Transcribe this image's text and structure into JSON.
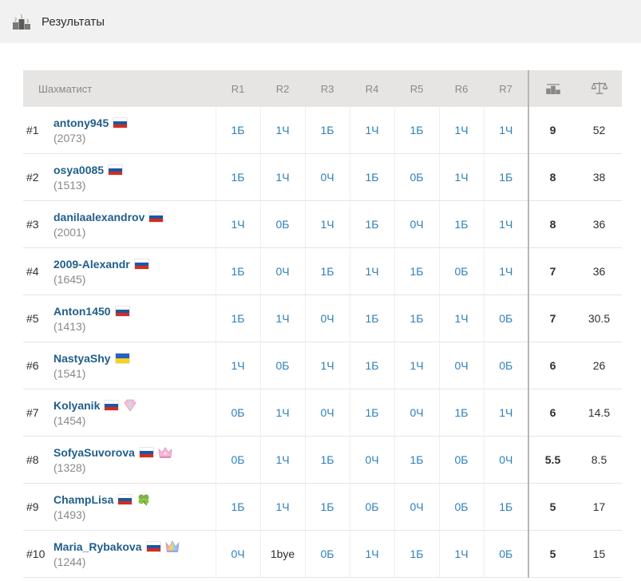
{
  "header": {
    "title": "Результаты"
  },
  "table": {
    "headers": {
      "player": "Шахматист",
      "rounds": [
        "R1",
        "R2",
        "R3",
        "R4",
        "R5",
        "R6",
        "R7"
      ]
    },
    "rows": [
      {
        "rank": "#1",
        "name": "antony945",
        "rating": "(2073)",
        "flag": "ru",
        "badge": "",
        "results": [
          "1Б",
          "1Ч",
          "1Б",
          "1Ч",
          "1Б",
          "1Ч",
          "1Ч"
        ],
        "points": "9",
        "tiebreak": "52"
      },
      {
        "rank": "#2",
        "name": "osya0085",
        "rating": "(1513)",
        "flag": "ru",
        "badge": "",
        "results": [
          "1Б",
          "1Ч",
          "0Ч",
          "1Б",
          "0Б",
          "1Ч",
          "1Б"
        ],
        "points": "8",
        "tiebreak": "38"
      },
      {
        "rank": "#3",
        "name": "danilaalexandrov",
        "rating": "(2001)",
        "flag": "ru",
        "badge": "",
        "results": [
          "1Ч",
          "0Б",
          "1Ч",
          "1Б",
          "0Ч",
          "1Б",
          "1Ч"
        ],
        "points": "8",
        "tiebreak": "36"
      },
      {
        "rank": "#4",
        "name": "2009-Alexandr",
        "rating": "(1645)",
        "flag": "ru",
        "badge": "",
        "results": [
          "1Б",
          "0Ч",
          "1Б",
          "1Ч",
          "1Б",
          "0Б",
          "1Ч"
        ],
        "points": "7",
        "tiebreak": "36"
      },
      {
        "rank": "#5",
        "name": "Anton1450",
        "rating": "(1413)",
        "flag": "ru",
        "badge": "",
        "results": [
          "1Б",
          "1Ч",
          "0Ч",
          "1Б",
          "1Б",
          "1Ч",
          "0Б"
        ],
        "points": "7",
        "tiebreak": "30.5"
      },
      {
        "rank": "#6",
        "name": "NastyaShy",
        "rating": "(1541)",
        "flag": "ua",
        "badge": "",
        "results": [
          "1Ч",
          "0Б",
          "1Ч",
          "1Б",
          "1Ч",
          "0Ч",
          "0Б"
        ],
        "points": "6",
        "tiebreak": "26"
      },
      {
        "rank": "#7",
        "name": "Kolyanik",
        "rating": "(1454)",
        "flag": "ru",
        "badge": "diamond-icon",
        "results": [
          "0Б",
          "1Ч",
          "0Ч",
          "1Б",
          "0Ч",
          "1Б",
          "1Ч"
        ],
        "points": "6",
        "tiebreak": "14.5"
      },
      {
        "rank": "#8",
        "name": "SofyaSuvorova",
        "rating": "(1328)",
        "flag": "ru",
        "badge": "crown-icon",
        "results": [
          "0Б",
          "1Ч",
          "1Б",
          "0Ч",
          "1Б",
          "0Б",
          "0Ч"
        ],
        "points": "5.5",
        "tiebreak": "8.5"
      },
      {
        "rank": "#9",
        "name": "ChampLisa",
        "rating": "(1493)",
        "flag": "ru",
        "badge": "clover-icon",
        "results": [
          "1Б",
          "1Ч",
          "1Б",
          "0Б",
          "0Ч",
          "0Б",
          "1Б"
        ],
        "points": "5",
        "tiebreak": "17"
      },
      {
        "rank": "#10",
        "name": "Maria_Rybakova",
        "rating": "(1244)",
        "flag": "ru",
        "badge": "rainbow-crown-icon",
        "results": [
          "0Ч",
          "1bye",
          "0Б",
          "1Ч",
          "1Б",
          "1Ч",
          "0Б"
        ],
        "points": "5",
        "tiebreak": "15"
      }
    ]
  }
}
